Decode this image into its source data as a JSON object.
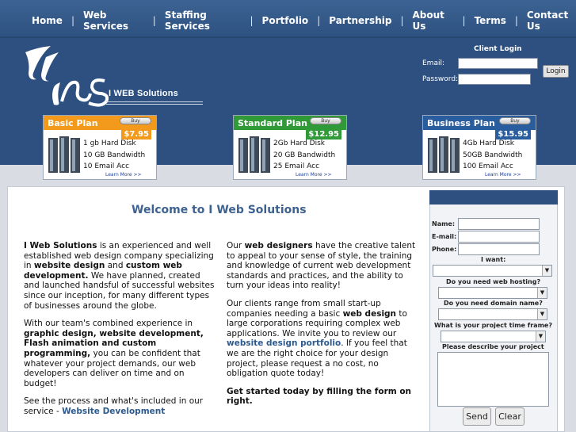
{
  "nav": {
    "items": [
      "Home",
      "Web Services",
      "Staffing Services",
      "Portfolio",
      "Partnership",
      "About Us",
      "Terms",
      "Contact Us"
    ],
    "separator": "|"
  },
  "logo": {
    "text": "I WEB Solutions",
    "mark": "iws"
  },
  "login": {
    "title": "Client Login",
    "email_label": "Email:",
    "password_label": "Password:",
    "button": "Login"
  },
  "plans": [
    {
      "name": "Basic Plan",
      "buy": "Buy",
      "price": "$7.95",
      "features": [
        "1 gb Hard Disk",
        "10 GB Bandwidth",
        "10 Email Acc"
      ],
      "learn": "Learn More >>",
      "color": "#f39a1d"
    },
    {
      "name": "Standard Plan",
      "buy": "Buy",
      "price": "$12.95",
      "features": [
        "2Gb Hard Disk",
        "20 GB Bandwidth",
        "25 Email Acc"
      ],
      "learn": "Learn More >>",
      "color": "#2f9a37"
    },
    {
      "name": "Business Plan",
      "buy": "Buy",
      "price": "$15.95",
      "features": [
        "4Gb Hard Disk",
        "50GB Bandwidth",
        "100 Email Acc"
      ],
      "learn": "Learn More >>",
      "color": "#2a5d9e"
    }
  ],
  "welcome": "Welcome to I Web Solutions",
  "left_col": {
    "p1_a": "I Web Solutions",
    "p1_b": " is an experienced and well established web design company specializing in ",
    "p1_c": "website design",
    "p1_d": " and ",
    "p1_e": "custom web development.",
    "p1_f": " We have planned, created and launched handsful of successful websites since our inception, for many different types of businesses around the globe.",
    "p2_a": "With our team's combined experience in ",
    "p2_b": "graphic design, website development, Flash animation and custom programming,",
    "p2_c": " you can be confident that whatever your project demands, our web developers can deliver on time and on budget!",
    "p3_a": "See the process and what's included in our service - ",
    "p3_link": "Website Development"
  },
  "right_col": {
    "p1_a": "Our ",
    "p1_b": "web designers",
    "p1_c": " have the creative talent to appeal to your sense of style, the training and knowledge of current web development standards and practices, and the ability to turn your ideas into reality!",
    "p2_a": "Our clients range from small start-up companies needing a basic ",
    "p2_b": "web design",
    "p2_c": " to large corporations requiring complex web applications. We invite you to review our ",
    "p2_link": "website design portfolio",
    "p2_d": ". If you feel that we are the right choice for your design project, please request a no cost, no obligation quote today!",
    "p3": "Get started today by filling the form on right."
  },
  "form": {
    "name_label": "Name:",
    "email_label": "E-mail:",
    "phone_label": "Phone:",
    "want_label": "I want:",
    "hosting_label": "Do you need web hosting?",
    "domain_label": "Do you need domain name?",
    "timeframe_label": "What is your project time frame?",
    "describe_label": "Please describe your project",
    "send": "Send",
    "clear": "Clear"
  }
}
